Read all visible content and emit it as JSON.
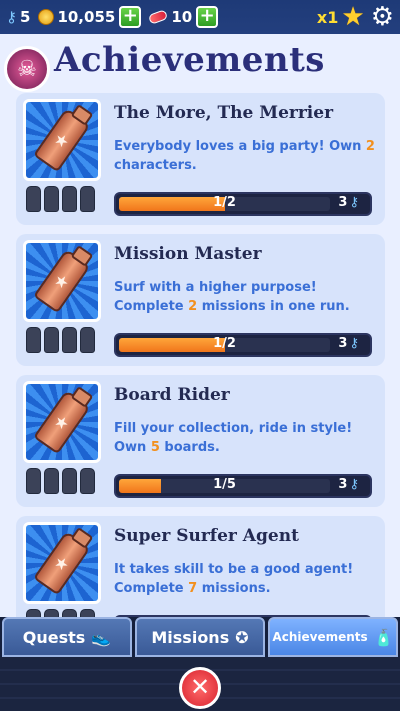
{
  "topbar": {
    "keys": "5",
    "coins": "10,055",
    "boards": "10",
    "multiplier": "x1",
    "plus": "+"
  },
  "header": {
    "title": "Achievements",
    "avatar_glyph": "☠"
  },
  "achievements": [
    {
      "title": "The More, The Merrier",
      "desc_before": "Everybody loves a big party! Own ",
      "desc_highlight": "2",
      "desc_after": " characters.",
      "progress_text": "1/2",
      "progress_fraction": 0.5,
      "reward": "3"
    },
    {
      "title": "Mission Master",
      "desc_before": "Surf with a higher purpose! Complete ",
      "desc_highlight": "2",
      "desc_after": " missions in one run.",
      "progress_text": "1/2",
      "progress_fraction": 0.5,
      "reward": "3"
    },
    {
      "title": "Board Rider",
      "desc_before": "Fill your collection, ride in style! Own ",
      "desc_highlight": "5",
      "desc_after": " boards.",
      "progress_text": "1/5",
      "progress_fraction": 0.2,
      "reward": "3"
    },
    {
      "title": "Super Surfer Agent",
      "desc_before": "It takes skill to be a good agent! Complete ",
      "desc_highlight": "7",
      "desc_after": " missions.",
      "progress_text": "",
      "progress_fraction": 0,
      "reward": ""
    }
  ],
  "tabs": [
    {
      "label": "Quests"
    },
    {
      "label": "Missions"
    },
    {
      "label": "Achievements"
    }
  ],
  "close_label": "✕",
  "colors": {
    "accent": "#f2901e",
    "link": "#3a6fd6",
    "title": "#2b2f7a"
  }
}
